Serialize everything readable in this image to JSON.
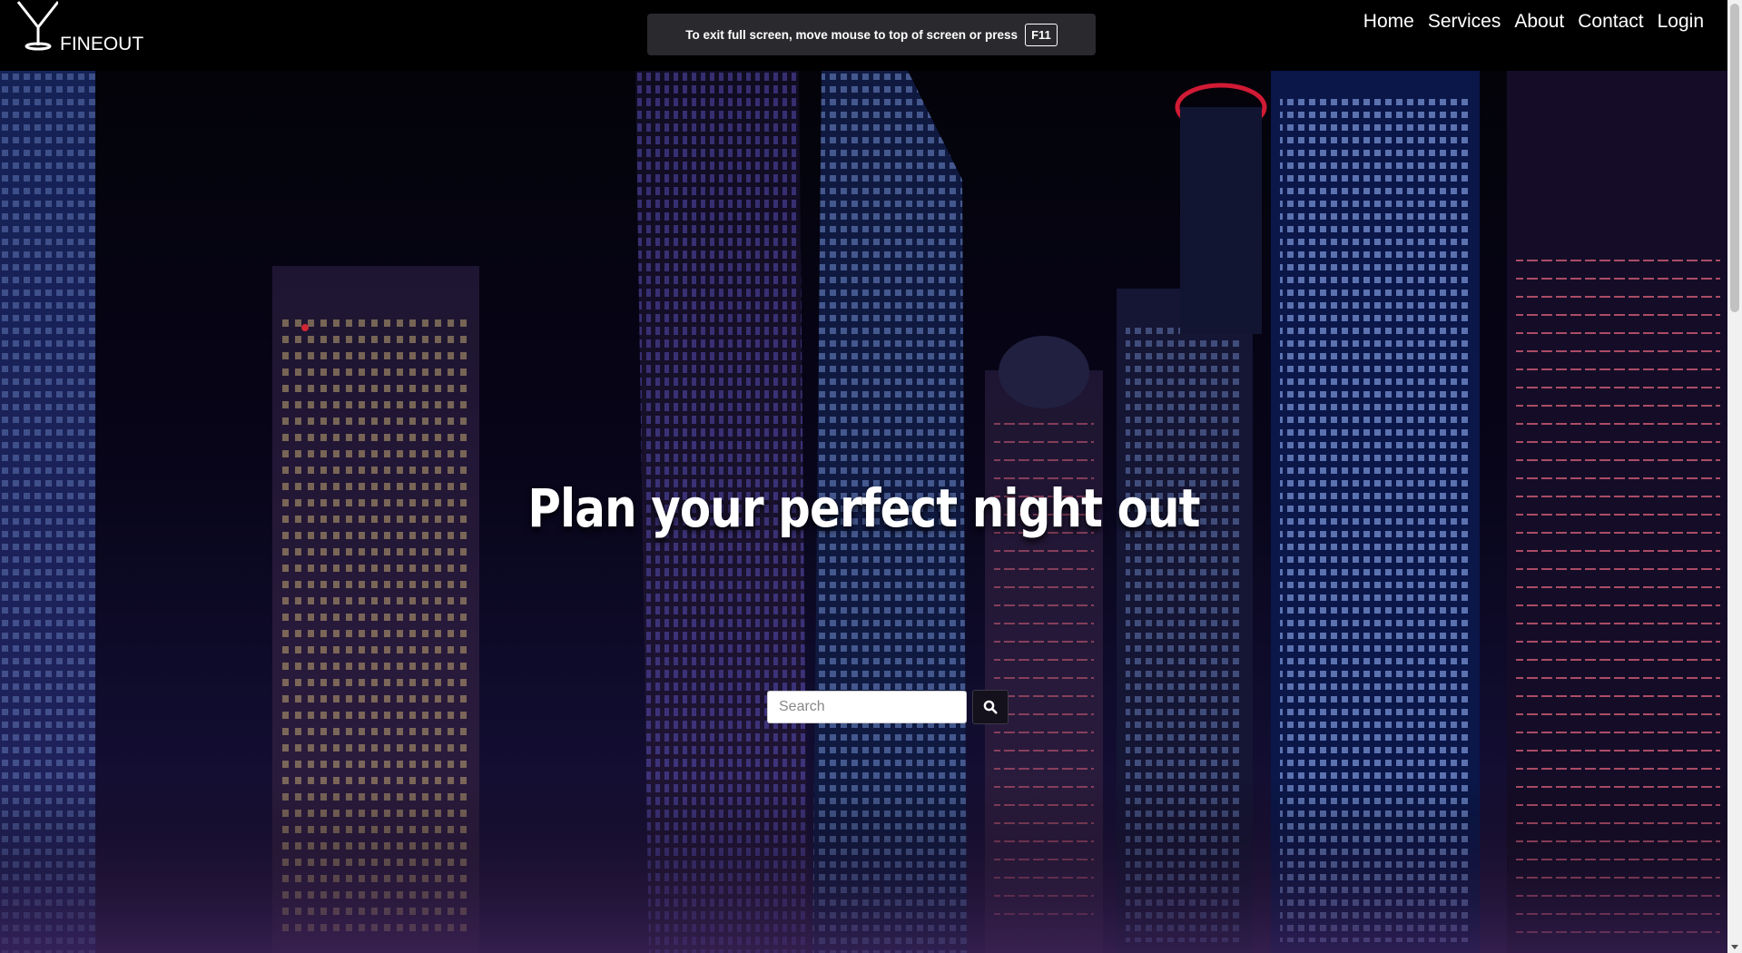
{
  "brand": {
    "name": "FINEOUT",
    "icon": "cocktail-glass-icon"
  },
  "nav": {
    "items": [
      {
        "label": "Home"
      },
      {
        "label": "Services"
      },
      {
        "label": "About"
      },
      {
        "label": "Contact"
      },
      {
        "label": "Login"
      }
    ]
  },
  "fullscreen_notice": {
    "text": "To exit full screen, move mouse to top of screen or press",
    "key": "F11"
  },
  "hero": {
    "title": "Plan your perfect night out",
    "background": "night city skyline"
  },
  "search": {
    "placeholder": "Search",
    "value": "",
    "button_icon": "search-icon"
  },
  "colors": {
    "navbar_bg": "#000000",
    "text": "#ffffff",
    "toast_bg": "#2a2a2e"
  }
}
